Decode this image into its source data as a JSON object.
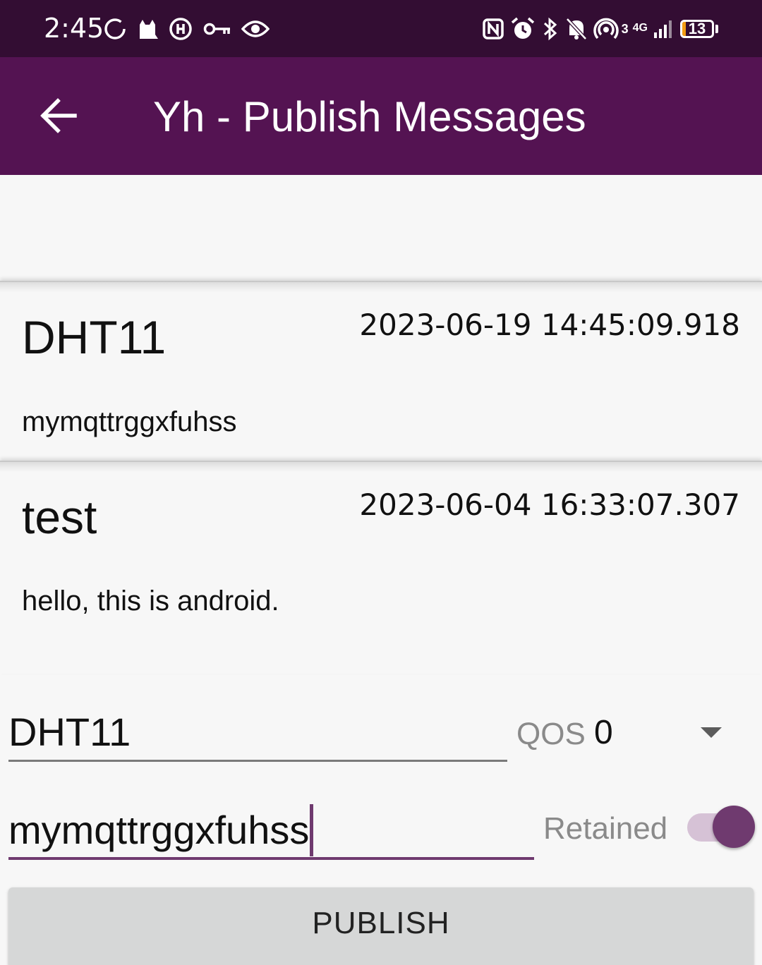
{
  "status_bar": {
    "time": "2:45",
    "left_icons": [
      "sync-circle-icon",
      "cat-icon",
      "data-saver-icon",
      "vpn-key-icon",
      "eye-icon"
    ],
    "right_icons": [
      "nfc-icon",
      "alarm-icon",
      "bluetooth-icon",
      "mute-bell-icon",
      "hotspot-icon",
      "network-4g-icon",
      "signal-icon"
    ],
    "network_sup": "3",
    "network_type": "4G",
    "battery_level": "13",
    "battery_color": "#f39c12"
  },
  "app_bar": {
    "title": "Yh - Publish Messages",
    "background": "#541352"
  },
  "messages": [
    {
      "topic": "DHT11",
      "timestamp": "2023-06-19 14:45:09.918",
      "payload": "mymqttrggxfuhss"
    },
    {
      "topic": "test",
      "timestamp": "2023-06-04 16:33:07.307",
      "payload": "hello, this is android."
    }
  ],
  "publish_form": {
    "topic_value": "DHT11",
    "qos_label": "QOS",
    "qos_value": "0",
    "message_value": "mymqttrggxfuhss",
    "retained_label": "Retained",
    "retained_on": true,
    "publish_label": "PUBLISH",
    "accent_color": "#6f3a6f"
  }
}
